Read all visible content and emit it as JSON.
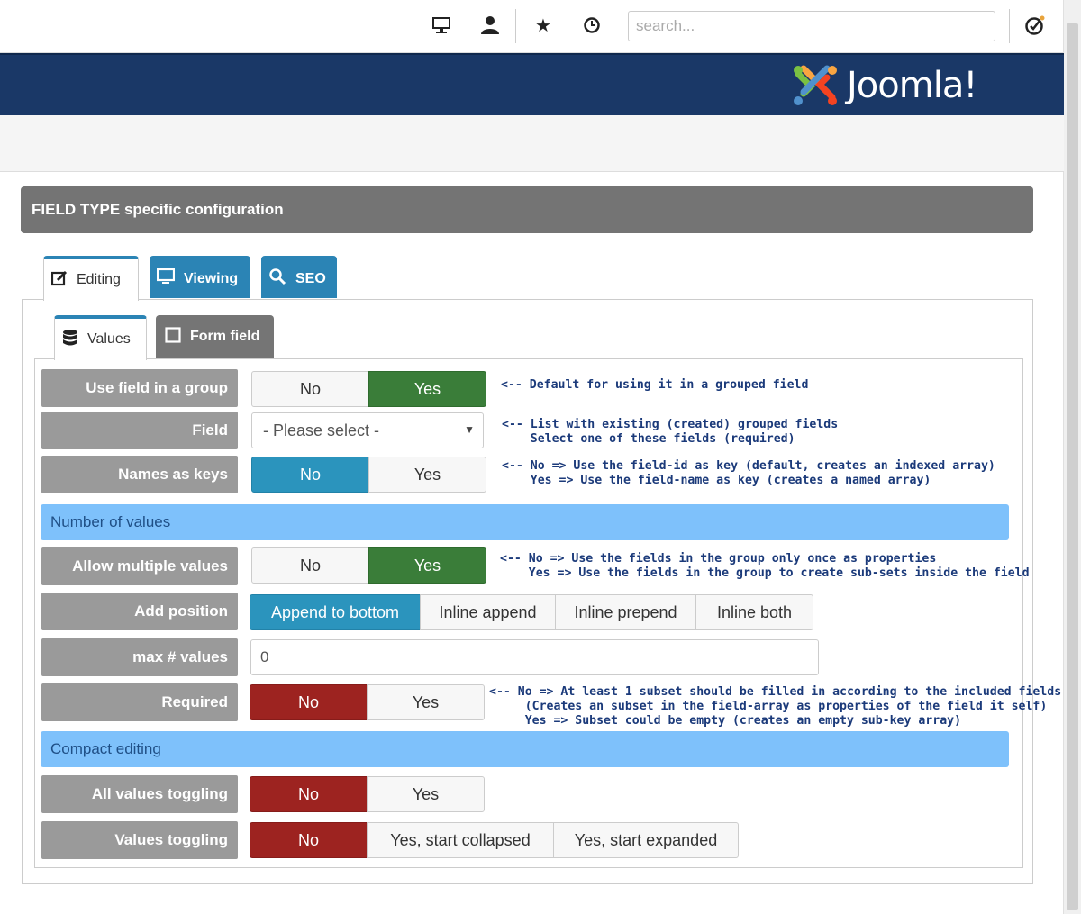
{
  "toolbar": {
    "search_placeholder": "search..."
  },
  "header": {
    "logo_text": "Joomla!"
  },
  "panel": {
    "title": "FIELD TYPE specific configuration"
  },
  "tabs": {
    "outer": [
      {
        "label": "Editing"
      },
      {
        "label": "Viewing"
      },
      {
        "label": "SEO"
      }
    ],
    "inner": [
      {
        "label": "Values"
      },
      {
        "label": "Form field"
      }
    ]
  },
  "rows": {
    "use_group": {
      "label": "Use field in a group",
      "options": [
        "No",
        "Yes"
      ],
      "selected": "Yes",
      "note": "<-- Default for using it in a grouped field"
    },
    "field": {
      "label": "Field",
      "value": "- Please select -",
      "note": "<-- List with existing (created) grouped fields\n    Select one of these fields (required)"
    },
    "names_as_keys": {
      "label": "Names as keys",
      "options": [
        "No",
        "Yes"
      ],
      "selected": "No",
      "note": "<-- No => Use the field-id as key (default, creates an indexed array)\n    Yes => Use the field-name as key (creates a named array)"
    },
    "section_number": "Number of values",
    "allow_multiple": {
      "label": "Allow multiple values",
      "options": [
        "No",
        "Yes"
      ],
      "selected": "Yes",
      "note": "<-- No => Use the fields in the group only once as properties\n    Yes => Use the fields in the group to create sub-sets inside the field"
    },
    "add_position": {
      "label": "Add position",
      "options": [
        "Append to bottom",
        "Inline append",
        "Inline prepend",
        "Inline both"
      ],
      "selected": "Append to bottom"
    },
    "max_values": {
      "label": "max # values",
      "value": "0"
    },
    "required": {
      "label": "Required",
      "options": [
        "No",
        "Yes"
      ],
      "selected": "No",
      "note": "<-- No => At least 1 subset should be filled in according to the included fields\n     (Creates an subset in the field-array as properties of the field it self)\n     Yes => Subset could be empty (creates an empty sub-key array)"
    },
    "section_compact": "Compact editing",
    "all_values_toggling": {
      "label": "All values toggling",
      "options": [
        "No",
        "Yes"
      ],
      "selected": "No"
    },
    "values_toggling": {
      "label": "Values toggling",
      "options": [
        "No",
        "Yes, start collapsed",
        "Yes, start expanded"
      ],
      "selected": "No"
    }
  },
  "colors": {
    "header_bg": "#1a3867",
    "panel_head": "#747474",
    "label_bg": "#9a9a9a",
    "yes_green": "#3a7d39",
    "active_blue": "#2b94bd",
    "no_red": "#9d2320",
    "section_bg": "#7ec1fb",
    "note_text": "#1b3a7a"
  }
}
